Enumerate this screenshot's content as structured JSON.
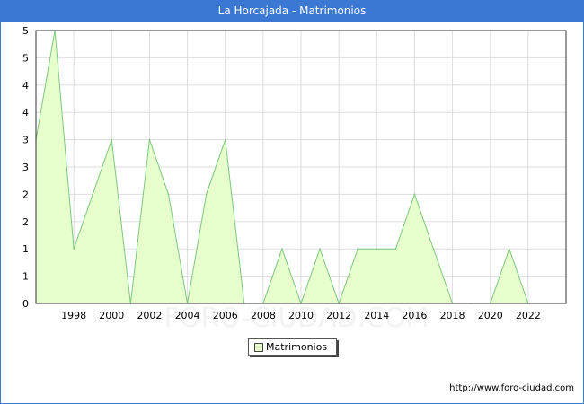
{
  "header": {
    "title": "La Horcajada - Matrimonios"
  },
  "watermark": "FORO-CIUDAD.COM",
  "source": "http://www.foro-ciudad.com",
  "chart_data": {
    "type": "area",
    "title": "La Horcajada - Matrimonios",
    "xlabel": "",
    "ylabel": "",
    "x": [
      1996,
      1997,
      1998,
      1999,
      2000,
      2001,
      2002,
      2003,
      2004,
      2005,
      2006,
      2007,
      2008,
      2009,
      2010,
      2011,
      2012,
      2013,
      2014,
      2015,
      2016,
      2017,
      2018,
      2019,
      2020,
      2021,
      2022
    ],
    "series": [
      {
        "name": "Matrimonios",
        "values": [
          3,
          5,
          1,
          2,
          3,
          0,
          3,
          2,
          0,
          2,
          3,
          0,
          0,
          1,
          0,
          1,
          0,
          1,
          1,
          1,
          2,
          1,
          0,
          0,
          0,
          1,
          0
        ],
        "color": "#e6ffcc",
        "line_color": "#7dc87d"
      }
    ],
    "x_tick_labels": [
      "1998",
      "2000",
      "2002",
      "2004",
      "2006",
      "2008",
      "2010",
      "2012",
      "2014",
      "2016",
      "2018",
      "2020",
      "2022"
    ],
    "y_tick_labels": [
      "0",
      "1",
      "1",
      "2",
      "2",
      "3",
      "3",
      "4",
      "4",
      "5",
      "5"
    ],
    "xlim": [
      1996,
      2024
    ],
    "ylim": [
      0,
      5
    ],
    "grid": true,
    "legend_position": "bottom-center"
  }
}
